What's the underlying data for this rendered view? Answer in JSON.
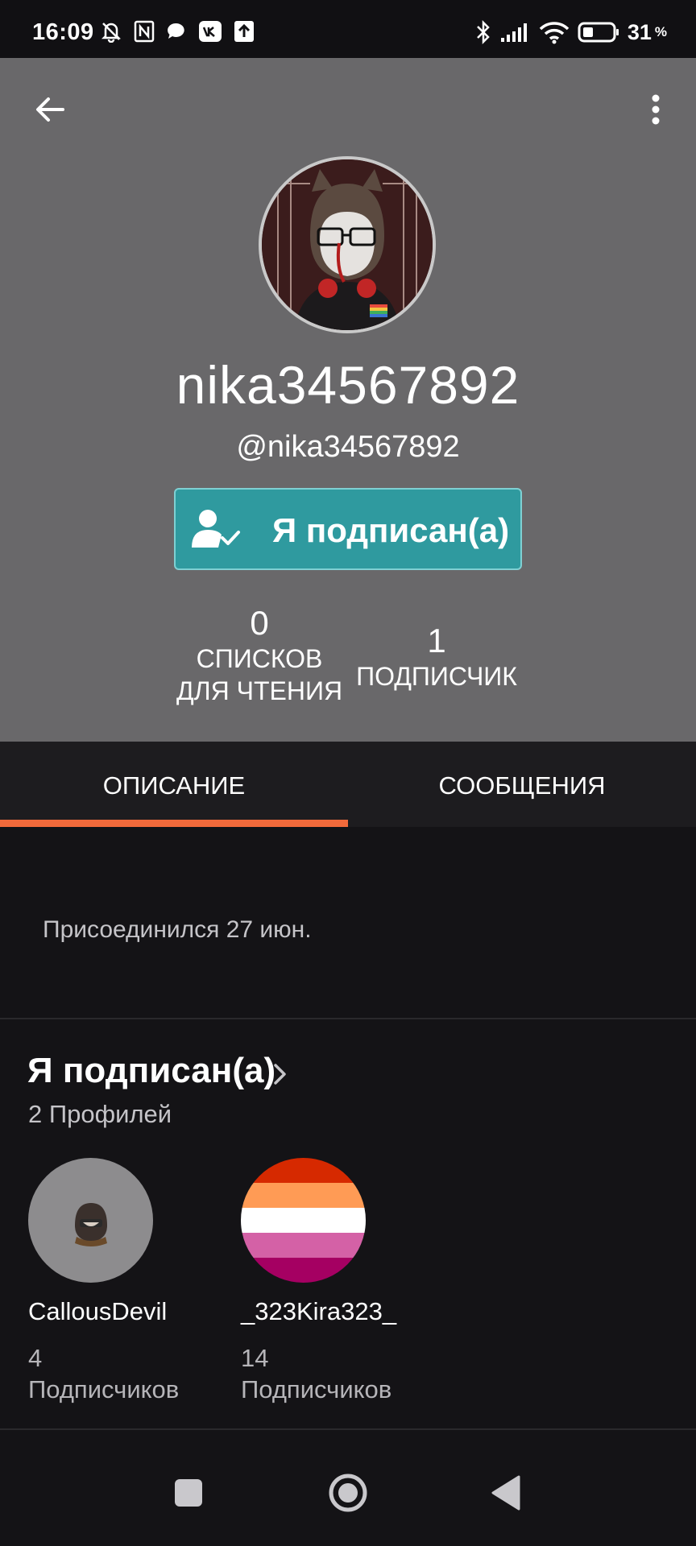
{
  "status_bar": {
    "time": "16:09",
    "battery": "31",
    "battery_unit": "%"
  },
  "profile": {
    "display_name": "nika34567892",
    "handle": "@nika34567892",
    "follow_button_label": "Я подписан(а)",
    "accent_color": "#2f9a9f"
  },
  "stats": [
    {
      "value": "0",
      "label_line1": "СПИСКОВ",
      "label_line2": "ДЛЯ ЧТЕНИЯ"
    },
    {
      "value": "1",
      "label_line1": "ПОДПИСЧИК"
    }
  ],
  "tabs": [
    {
      "label": "ОПИСАНИЕ",
      "active": true
    },
    {
      "label": "СООБЩЕНИЯ",
      "active": false
    }
  ],
  "tab_indicator_color": "#f26a3b",
  "about": {
    "joined": "Присоединился 27 июн."
  },
  "following": {
    "title": "Я подписан(а)",
    "count": "2 Профилей",
    "users": [
      {
        "name": "CallousDevil",
        "followers": "4",
        "followers_label": "Подписчиков"
      },
      {
        "name": "_323Kira323_",
        "followers": "14",
        "followers_label": "Подписчиков"
      }
    ]
  }
}
